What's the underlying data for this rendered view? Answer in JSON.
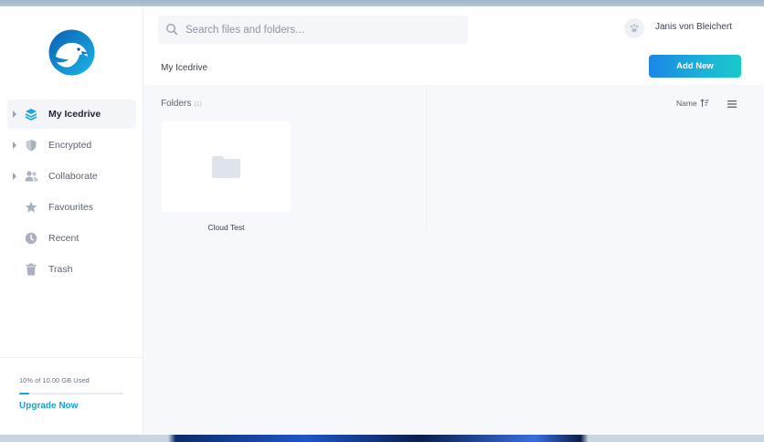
{
  "search": {
    "placeholder": "Search files and folders..."
  },
  "user": {
    "name": "Janis von Bleichert"
  },
  "breadcrumb": "My Icedrive",
  "actions": {
    "add_new": "Add New"
  },
  "sidebar": {
    "items": [
      {
        "label": "My Icedrive",
        "icon": "layers-icon",
        "active": true,
        "expandable": true
      },
      {
        "label": "Encrypted",
        "icon": "shield-icon",
        "active": false,
        "expandable": true
      },
      {
        "label": "Collaborate",
        "icon": "users-icon",
        "active": false,
        "expandable": true
      },
      {
        "label": "Favourites",
        "icon": "star-icon",
        "active": false,
        "expandable": false
      },
      {
        "label": "Recent",
        "icon": "clock-icon",
        "active": false,
        "expandable": false
      },
      {
        "label": "Trash",
        "icon": "trash-icon",
        "active": false,
        "expandable": false
      }
    ]
  },
  "storage": {
    "text": "10% of 10.00 GB Used",
    "used_fraction": 0.1,
    "upgrade_label": "Upgrade Now"
  },
  "content": {
    "section_title": "Folders",
    "folder_count": "(1)",
    "sort_label": "Name",
    "folders": [
      {
        "name": "Cloud Test"
      }
    ]
  },
  "colors": {
    "accent": "#1a9fd6",
    "button_gradient_start": "#1c86e6",
    "button_gradient_end": "#18c8c8"
  }
}
